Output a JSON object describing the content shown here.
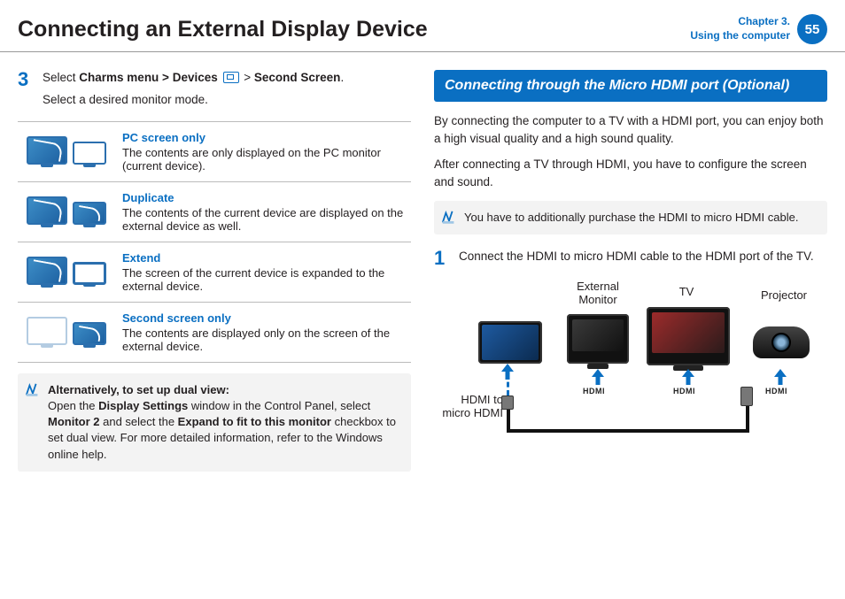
{
  "header": {
    "title": "Connecting an External Display Device",
    "chapter_line1": "Chapter 3.",
    "chapter_line2": "Using the computer",
    "page_number": "55"
  },
  "left": {
    "step_number": "3",
    "step_line1_pre": "Select ",
    "step_line1_bold": "Charms menu > Devices",
    "step_line1_mid": " > ",
    "step_line1_bold2": "Second Screen",
    "step_line1_post": ".",
    "step_line2": "Select a desired monitor mode.",
    "modes": [
      {
        "title": "PC screen only",
        "desc": "The contents are only displayed on the PC monitor (current device)."
      },
      {
        "title": "Duplicate",
        "desc": "The contents of the current device are displayed on the external device as well."
      },
      {
        "title": "Extend",
        "desc": "The screen of the current device is expanded to the external device."
      },
      {
        "title": "Second screen only",
        "desc": "The contents are displayed only on the screen of the external device."
      }
    ],
    "note_title": "Alternatively, to set up dual view:",
    "note_body_pre": "Open the ",
    "note_body_b1": "Display Settings",
    "note_body_mid1": " window in the Control Panel, select ",
    "note_body_b2": "Monitor 2",
    "note_body_mid2": " and select the ",
    "note_body_b3": "Expand to fit to this monitor",
    "note_body_post": " checkbox to set dual view. For more detailed information, refer to the Windows online help."
  },
  "right": {
    "banner": "Connecting through the Micro HDMI port (Optional)",
    "para1": "By connecting the computer to a TV with a HDMI port, you can enjoy both a high visual quality and a high sound quality.",
    "para2": "After connecting a TV through HDMI, you have to configure the screen and sound.",
    "note": "You have to additionally purchase the HDMI to micro HDMI cable.",
    "step_number": "1",
    "step_text": "Connect the HDMI to micro HDMI cable to the HDMI port of the TV.",
    "labels": {
      "ext_monitor": "External\nMonitor",
      "tv": "TV",
      "projector": "Projector",
      "hdmi_cable": "HDMI to\nmicro HDMI",
      "hdmi": "HDMI"
    }
  }
}
